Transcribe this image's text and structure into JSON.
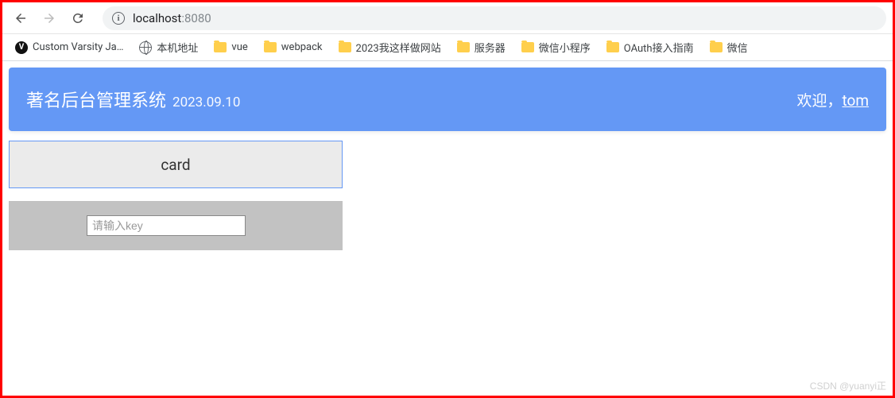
{
  "browser": {
    "url_host": "localhost",
    "url_port": ":8080",
    "info_glyph": "i"
  },
  "bookmarks": [
    {
      "icon": "fav-dark",
      "label": "Custom Varsity Ja…",
      "glyph": "V"
    },
    {
      "icon": "globe",
      "label": "本机地址"
    },
    {
      "icon": "folder",
      "label": "vue"
    },
    {
      "icon": "folder",
      "label": "webpack"
    },
    {
      "icon": "folder",
      "label": "2023我这样做网站"
    },
    {
      "icon": "folder",
      "label": "服务器"
    },
    {
      "icon": "folder",
      "label": "微信小程序"
    },
    {
      "icon": "folder",
      "label": "OAuth接入指南"
    },
    {
      "icon": "folder",
      "label": "微信"
    }
  ],
  "header": {
    "title": "著名后台管理系统",
    "date": "2023.09.10",
    "welcome_label": "欢迎，",
    "username": "tom"
  },
  "card": {
    "label": "card"
  },
  "input": {
    "placeholder": "请输入key",
    "value": ""
  },
  "watermark": "CSDN @yuanyi正"
}
